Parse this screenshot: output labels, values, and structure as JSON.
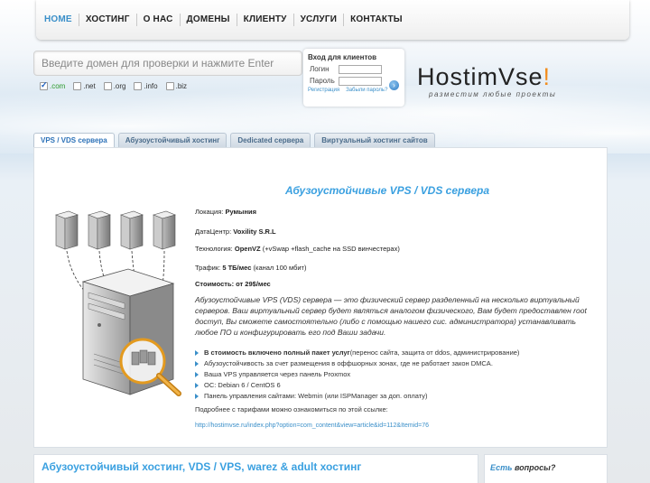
{
  "nav": {
    "items": [
      "HOME",
      "ХОСТИНГ",
      "О НАС",
      "ДОМЕНЫ",
      "КЛИЕНТУ",
      "УСЛУГИ",
      "КОНТАКТЫ"
    ],
    "active": "HOME"
  },
  "search": {
    "placeholder": "Введите домен для проверки и нажмите Enter",
    "zones": [
      {
        "label": ".com",
        "checked": true
      },
      {
        "label": ".net",
        "checked": false
      },
      {
        "label": ".org",
        "checked": false
      },
      {
        "label": ".info",
        "checked": false
      },
      {
        "label": ".biz",
        "checked": false
      }
    ]
  },
  "login": {
    "title": "Вход для клиентов",
    "login_label": "Логин",
    "password_label": "Пароль",
    "register_link": "Регистрация",
    "forgot_link": "Забыли пароль?"
  },
  "logo": {
    "part1": "Hostim",
    "part2": "Vse",
    "part3": "!",
    "tagline": "разместим любые проекты"
  },
  "tabs": [
    "VPS / VDS сервера",
    "Абузоустойчивый хостинг",
    "Dedicated сервера",
    "Виртуальный хостинг сайтов"
  ],
  "main": {
    "title": "Абузоустойчивые  VPS / VDS сервера",
    "location_label": "Локация: ",
    "location_value": "Румыния",
    "dc_label": "ДатаЦентр: ",
    "dc_value": "Voxility S.R.L",
    "tech_label": "Технология: ",
    "tech_value": "OpenVZ",
    "tech_extra": " (+vSwap +flash_cache на SSD винчестерах)",
    "traffic_label": "Трафик: ",
    "traffic_value": "5 ТБ/мес",
    "traffic_extra": " (канал 100 мбит)",
    "price": "Стоимость: от 29$/мес",
    "description": "Абузоустойчивые VPS (VDS) сервера — это физический сервер разделенный на несколько виртуальный серверов. Ваш виртуальный сервер будет являться аналогом физического, Вам будет предоставлен root доступ, Вы сможете самостоятельно (либо с помощью нашего сис. администратора) устанавливать любое ПО и конфигурировать его под Ваши задачи.",
    "bullet1_bold": "В стоимость включено полный пакет услуг",
    "bullet1_rest": " (перенос сайта, защита от ddos, администрирование)",
    "bullet2": "Абузоустойчивость за счет размещения в оффшорных зонах, где не работает закон DMCA.",
    "bullet3": "Ваша VPS управляется через панель Proxmox",
    "bullet4": "ОС: Debian 6 / CentOS 6",
    "bullet5": "Панель управления сайтами: Webmin (или ISPManager за доп. оплату)",
    "more": "Подробнее с тарифами можно ознакомиться по этой ссылке:",
    "link": "http://hostimvse.ru/index.php?option=com_content&view=article&id=112&Itemid=76"
  },
  "bottom": {
    "heading": "Абузоустойчивый хостинг, VDS / VPS, warez & adult хостинг",
    "side_accent": "Есть",
    "side_rest": " вопросы?"
  }
}
